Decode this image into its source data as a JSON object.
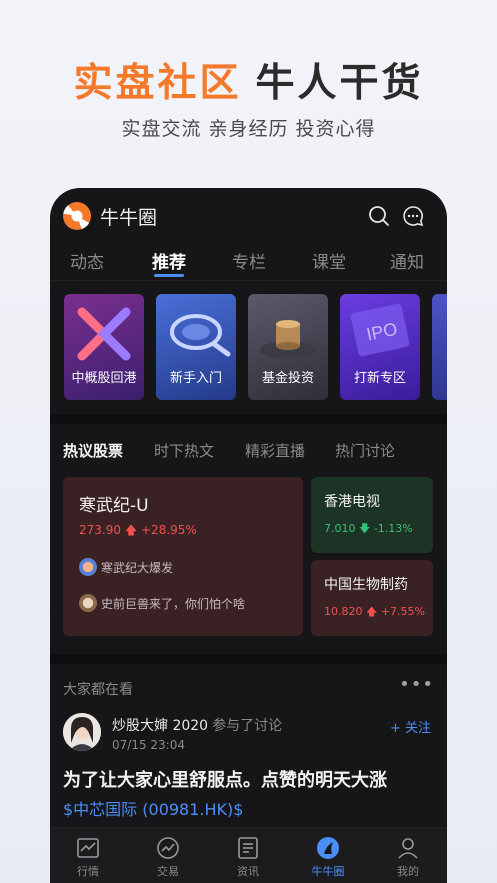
{
  "promo": {
    "title_accent": "实盘社区",
    "title_dark": "牛人干货",
    "subtitle": "实盘交流 亲身经历 投资心得",
    "accent_color": "#f4792b"
  },
  "app": {
    "name": "牛牛圈",
    "search_icon": "search-icon",
    "chat_icon": "chat-icon"
  },
  "main_tabs": [
    {
      "label": "动态"
    },
    {
      "label": "推荐",
      "active": true
    },
    {
      "label": "专栏"
    },
    {
      "label": "课堂"
    },
    {
      "label": "通知"
    }
  ],
  "feature_cards": [
    {
      "label": "中概股回港"
    },
    {
      "label": "新手入门"
    },
    {
      "label": "基金投资"
    },
    {
      "label": "打新专区"
    }
  ],
  "hot_tabs": [
    {
      "label": "热议股票",
      "active": true
    },
    {
      "label": "时下热文"
    },
    {
      "label": "精彩直播"
    },
    {
      "label": "热门讨论"
    }
  ],
  "hot_stocks": {
    "main": {
      "name": "寒武纪-U",
      "price": "273.90",
      "change": "+28.95%",
      "direction": "up",
      "tags": [
        "寒武纪大爆发",
        "史前巨兽来了，你们怕个啥"
      ]
    },
    "side": [
      {
        "name": "香港电视",
        "price": "7.010",
        "change": "-1.13%",
        "direction": "down"
      },
      {
        "name": "中国生物制药",
        "price": "10.820",
        "change": "+7.55%",
        "direction": "up"
      }
    ]
  },
  "everyone": {
    "title": "大家都在看",
    "more": "•••",
    "post": {
      "user": "炒股大婶 2020",
      "action": "参与了讨论",
      "time": "07/15 23:04",
      "follow": "+ 关注",
      "text": "为了让大家心里舒服点。点赞的明天大涨",
      "stock": "$中芯国际 (00981.HK)$"
    }
  },
  "bottom_nav": [
    {
      "label": "行情",
      "icon": "chart-icon"
    },
    {
      "label": "交易",
      "icon": "trade-icon"
    },
    {
      "label": "资讯",
      "icon": "news-icon"
    },
    {
      "label": "牛牛圈",
      "icon": "circle-icon",
      "active": true
    },
    {
      "label": "我的",
      "icon": "profile-icon"
    }
  ],
  "colors": {
    "up": "#f0514f",
    "down": "#33c27a",
    "link": "#4b8ef7"
  }
}
